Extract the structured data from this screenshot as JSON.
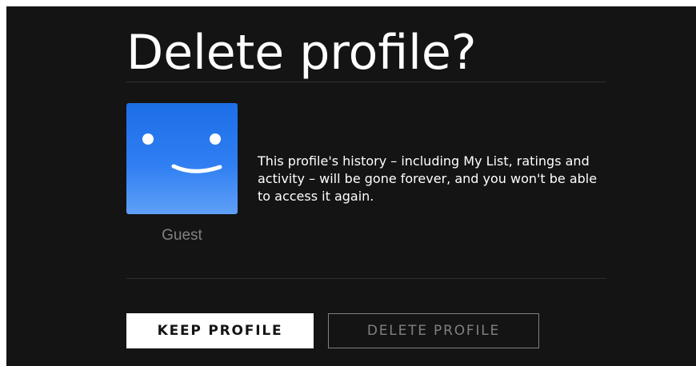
{
  "dialog": {
    "title": "Delete profile?",
    "message": "This profile's history – including My List, ratings and activity – will be gone forever, and you won't be able to access it again."
  },
  "profile": {
    "name": "Guest",
    "avatar_icon": "smiley-face-icon",
    "avatar_color": "#2f7ef2"
  },
  "buttons": {
    "keep_label": "KEEP PROFILE",
    "delete_label": "DELETE PROFILE"
  },
  "colors": {
    "background": "#141414",
    "text": "#ffffff",
    "muted": "#808080"
  }
}
